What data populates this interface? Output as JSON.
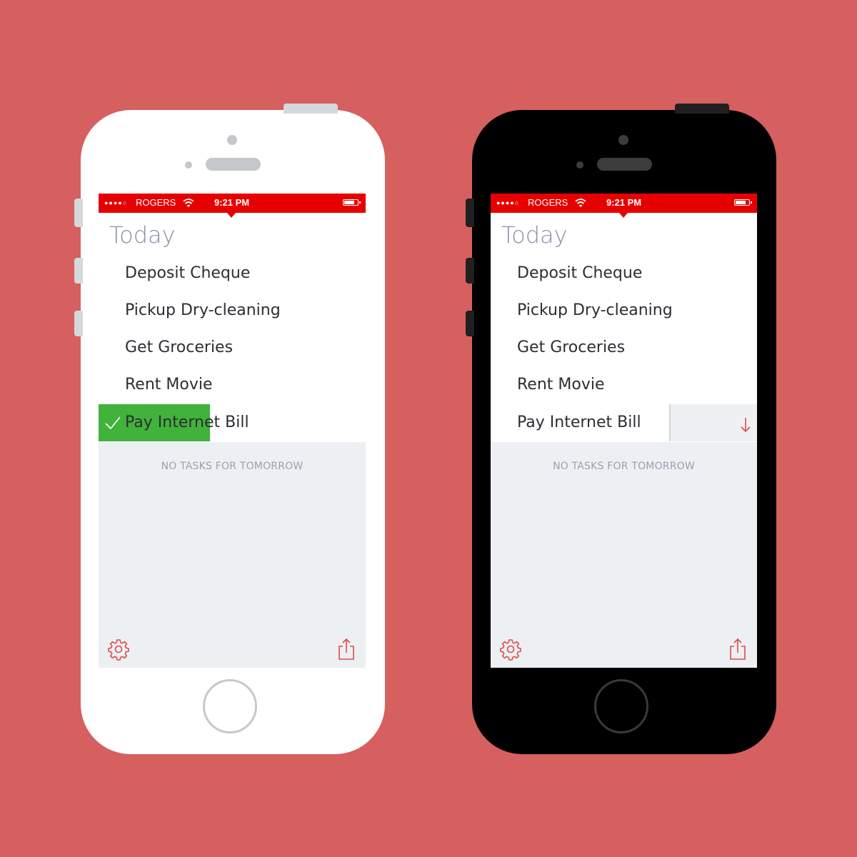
{
  "colors": {
    "background": "#d65f5f",
    "status_bar": "#e60000",
    "complete_green": "#41b23a",
    "accent_red": "#e24a4a"
  },
  "status_bar": {
    "signal": "●●●●○",
    "carrier": "ROGERS",
    "wifi_icon": "wifi-icon",
    "time": "9:21 PM",
    "battery_icon": "battery-icon"
  },
  "today": {
    "title": "Today",
    "tasks": [
      {
        "label": "Deposit Cheque"
      },
      {
        "label": "Pickup Dry-cleaning"
      },
      {
        "label": "Get Groceries"
      },
      {
        "label": "Rent Movie"
      },
      {
        "label": "Pay Internet Bill"
      }
    ]
  },
  "tomorrow": {
    "empty_text": "NO TASKS FOR TOMORROW"
  },
  "toolbar": {
    "settings_icon": "gear-icon",
    "share_icon": "share-icon"
  },
  "left_phone": {
    "frame": "white",
    "swipe_action": "complete",
    "swipe_icon": "checkmark-icon"
  },
  "right_phone": {
    "frame": "black",
    "swipe_action": "move to tomorrow",
    "swipe_icon": "arrow-down-icon"
  }
}
